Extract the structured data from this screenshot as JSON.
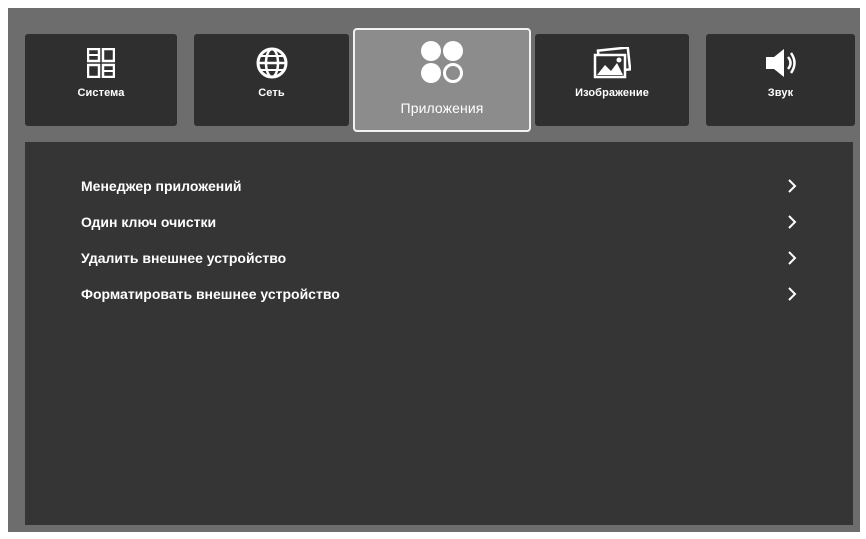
{
  "tabs": [
    {
      "label": "Система",
      "icon": "grid-icon"
    },
    {
      "label": "Сеть",
      "icon": "globe-icon"
    },
    {
      "label": "Приложения",
      "icon": "apps-icon",
      "active": true
    },
    {
      "label": "Изображение",
      "icon": "picture-icon"
    },
    {
      "label": "Звук",
      "icon": "speaker-icon"
    }
  ],
  "menu": [
    {
      "label": "Менеджер приложений"
    },
    {
      "label": "Один ключ очистки"
    },
    {
      "label": "Удалить внешнее устройство"
    },
    {
      "label": "Форматировать внешнее устройство"
    }
  ],
  "colors": {
    "background": "#6d6d6d",
    "tab": "#2f2f2f",
    "tab_active": "#8c8c8c",
    "panel": "#353535",
    "text": "#ffffff"
  }
}
